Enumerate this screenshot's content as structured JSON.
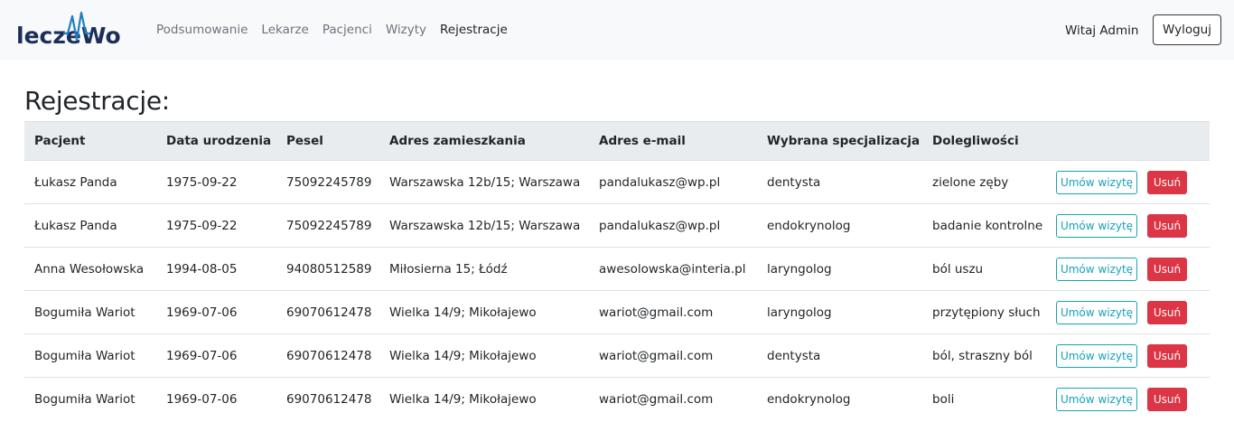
{
  "brand": {
    "name": "leczeWo",
    "color": "#1c2f5a",
    "accent": "#1f7fbf"
  },
  "nav": {
    "links": [
      {
        "label": "Podsumowanie",
        "active": false
      },
      {
        "label": "Lekarze",
        "active": false
      },
      {
        "label": "Pacjenci",
        "active": false
      },
      {
        "label": "Wizyty",
        "active": false
      },
      {
        "label": "Rejestracje",
        "active": true
      }
    ],
    "greeting": "Witaj Admin",
    "logout_label": "Wyloguj"
  },
  "page": {
    "title": "Rejestracje:"
  },
  "table": {
    "headers": [
      "Pacjent",
      "Data urodzenia",
      "Pesel",
      "Adres zamieszkania",
      "Adres e-mail",
      "Wybrana specjalizacja",
      "Dolegliwości",
      ""
    ],
    "appoint_label": "Umów wizytę",
    "delete_label": "Usuń",
    "rows": [
      [
        "Łukasz Panda",
        "1975-09-22",
        "75092245789",
        "Warszawska 12b/15; Warszawa",
        "pandalukasz@wp.pl",
        "dentysta",
        "zielone zęby"
      ],
      [
        "Łukasz Panda",
        "1975-09-22",
        "75092245789",
        "Warszawska 12b/15; Warszawa",
        "pandalukasz@wp.pl",
        "endokrynolog",
        "badanie kontrolne"
      ],
      [
        "Anna Wesołowska",
        "1994-08-05",
        "94080512589",
        "Miłosierna 15; Łódź",
        "awesolowska@interia.pl",
        "laryngolog",
        "ból uszu"
      ],
      [
        "Bogumiła Wariot",
        "1969-07-06",
        "69070612478",
        "Wielka 14/9; Mikołajewo",
        "wariot@gmail.com",
        "laryngolog",
        "przytępiony słuch"
      ],
      [
        "Bogumiła Wariot",
        "1969-07-06",
        "69070612478",
        "Wielka 14/9; Mikołajewo",
        "wariot@gmail.com",
        "dentysta",
        "ból, straszny ból"
      ],
      [
        "Bogumiła Wariot",
        "1969-07-06",
        "69070612478",
        "Wielka 14/9; Mikołajewo",
        "wariot@gmail.com",
        "endokrynolog",
        "boli"
      ]
    ]
  },
  "colors": {
    "info": "#17a2b8",
    "danger": "#dc3545",
    "navbar_bg": "#f8f9fa",
    "header_bg": "#e9ecef"
  }
}
